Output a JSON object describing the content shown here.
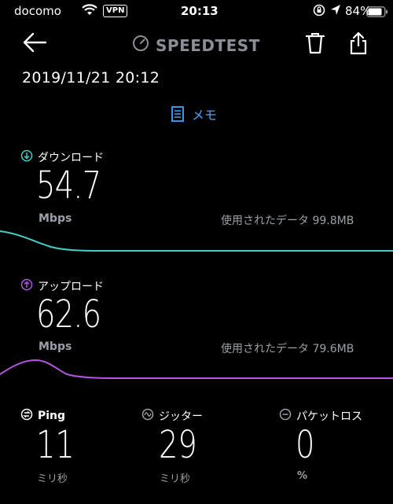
{
  "status_bar": {
    "carrier": "docomo",
    "vpn": "VPN",
    "time": "20:13",
    "battery": "84%"
  },
  "header": {
    "title": "SPEEDTEST"
  },
  "datetime": "2019/11/21 20:12",
  "memo_label": "メモ",
  "download": {
    "label": "ダウンロード",
    "value": "54.7",
    "unit": "Mbps",
    "data_used": "使用されたデータ 99.8MB",
    "color": "#3fd0c9"
  },
  "upload": {
    "label": "アップロード",
    "value": "62.6",
    "unit": "Mbps",
    "data_used": "使用されたデータ 79.6MB",
    "color": "#b355e6"
  },
  "metrics": {
    "ping": {
      "label": "Ping",
      "value": "11",
      "unit": "ミリ秒"
    },
    "jitter": {
      "label": "ジッター",
      "value": "29",
      "unit": "ミリ秒"
    },
    "packet_loss": {
      "label": "パケットロス",
      "value": "0",
      "unit": "%"
    }
  }
}
